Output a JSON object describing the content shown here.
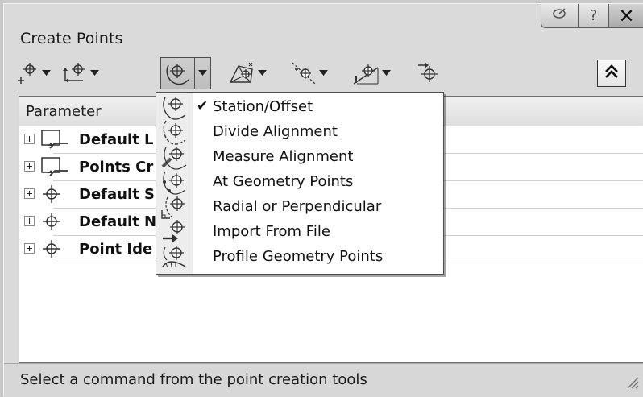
{
  "window": {
    "title": "Create Points",
    "buttons": {
      "pin_icon": "pushpin-icon",
      "help": "?",
      "close": "✕"
    }
  },
  "toolbar": {
    "tools": [
      {
        "name": "miscellaneous-points",
        "icon": "point-plus-icon"
      },
      {
        "name": "intersection-points",
        "icon": "point-arrows-icon"
      },
      {
        "name": "alignment-points",
        "icon": "alignment-point-icon",
        "pressed": true
      },
      {
        "name": "surface-points",
        "icon": "surface-point-icon"
      },
      {
        "name": "interpolate-points",
        "icon": "interpolate-point-icon"
      },
      {
        "name": "slope-points",
        "icon": "slope-point-icon"
      },
      {
        "name": "convert-points",
        "icon": "convert-point-icon"
      }
    ],
    "collapse_icon": "chevron-double-up-icon"
  },
  "panel": {
    "column_header": "Parameter",
    "rows": [
      {
        "label": "Default L",
        "icon": "layer-icon"
      },
      {
        "label": "Points Cr",
        "icon": "layer-icon"
      },
      {
        "label": "Default S",
        "icon": "point-icon"
      },
      {
        "label": "Default N",
        "icon": "point-icon"
      },
      {
        "label": "Point Ide",
        "icon": "point-icon"
      }
    ]
  },
  "menu": {
    "items": [
      {
        "label": "Station/Offset",
        "checked": true,
        "icon": "station-offset-icon"
      },
      {
        "label": "Divide Alignment",
        "checked": false,
        "icon": "divide-alignment-icon"
      },
      {
        "label": "Measure Alignment",
        "checked": false,
        "icon": "measure-alignment-icon"
      },
      {
        "label": "At Geometry Points",
        "checked": false,
        "icon": "geometry-points-icon"
      },
      {
        "label": "Radial or Perpendicular",
        "checked": false,
        "icon": "radial-perpendicular-icon"
      },
      {
        "label": "Import From File",
        "checked": false,
        "icon": "import-file-icon"
      },
      {
        "label": "Profile Geometry Points",
        "checked": false,
        "icon": "profile-geometry-icon"
      }
    ],
    "check_glyph": "✔"
  },
  "status": {
    "text": "Select a command from the point creation tools"
  }
}
